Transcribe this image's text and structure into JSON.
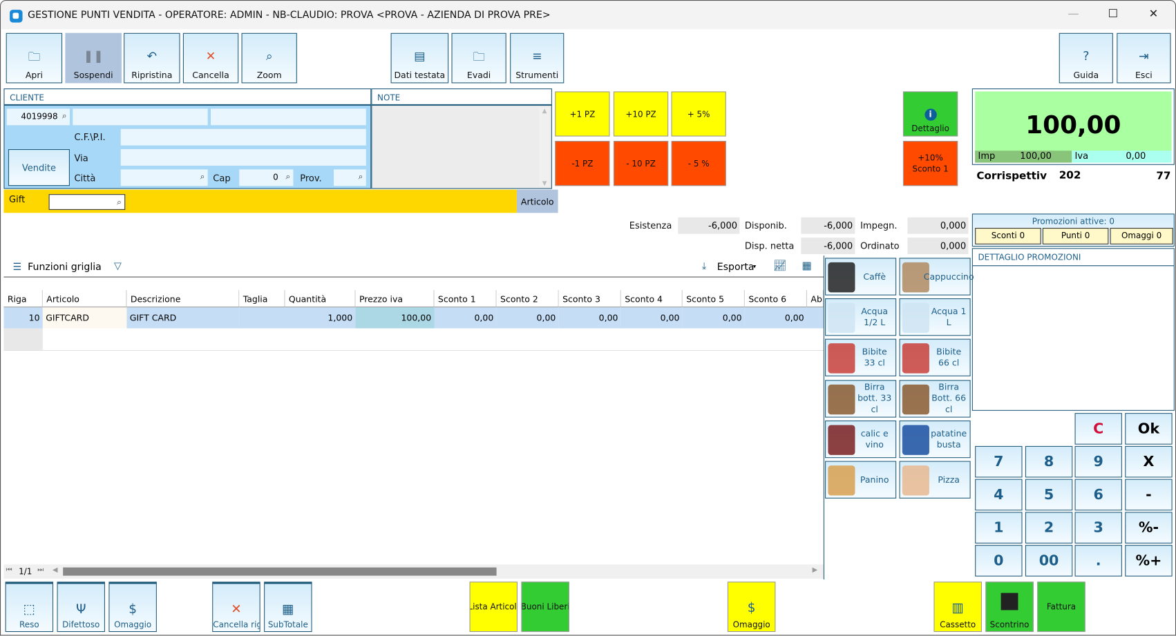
{
  "window": {
    "title": "GESTIONE PUNTI VENDITA - OPERATORE: ADMIN - NB-CLAUDIO: PROVA <PROVA - AZIENDA DI PROVA PRE>",
    "minimize": "—",
    "maximize": "☐",
    "close": "✕"
  },
  "toolbar": [
    {
      "label": "Apri",
      "icon": "folder-icon",
      "glyph": "🗀"
    },
    {
      "label": "Sospendi",
      "icon": "pause-icon",
      "glyph": "❚❚"
    },
    {
      "label": "Ripristina",
      "icon": "undo-icon",
      "glyph": "↶"
    },
    {
      "label": "Cancella",
      "icon": "close-icon",
      "glyph": "✕"
    },
    {
      "label": "Zoom",
      "icon": "search-icon",
      "glyph": "⌕"
    },
    {
      "label": "Dati testata",
      "icon": "document-icon",
      "glyph": "▤"
    },
    {
      "label": "Evadi",
      "icon": "folder-star-icon",
      "glyph": "🗀"
    },
    {
      "label": "Strumenti",
      "icon": "menu-icon",
      "glyph": "≡"
    },
    {
      "label": "Guida",
      "icon": "help-icon",
      "glyph": "?"
    },
    {
      "label": "Esci",
      "icon": "exit-icon",
      "glyph": "⇥"
    }
  ],
  "cliente": {
    "header": "CLIENTE",
    "code": "4019998",
    "name1": "",
    "name2": "",
    "cfpi_label": "C.F.\\P.I.",
    "cfpi": "",
    "vendite": "Vendite",
    "via_label": "Via",
    "via": "",
    "citta_label": "Città",
    "citta": "",
    "cap_label": "Cap",
    "cap": "0",
    "prov_label": "Prov.",
    "prov": ""
  },
  "note": {
    "header": "NOTE"
  },
  "quick": {
    "plus1": "+1 PZ",
    "plus10": "+10 PZ",
    "plus5pct": "+ 5%",
    "minus1": "-1 PZ",
    "minus10": "- 10 PZ",
    "minus5pct": "- 5 %",
    "dettaglio": "Dettaglio",
    "sconto": "+10%\nSconto 1"
  },
  "total": {
    "amount": "100,00",
    "imp_label": "Imp",
    "imp": "100,00",
    "iva_label": "Iva",
    "iva": "0,00",
    "corr_label": "Corrispettiv",
    "corr_num": "202",
    "corr_right": "77"
  },
  "gift": {
    "label": "Gift",
    "value": "",
    "articolo": "Articolo"
  },
  "stock": {
    "esistenza_label": "Esistenza",
    "esistenza": "-6,000",
    "disponib_label": "Disponib.",
    "disponib": "-6,000",
    "impegn_label": "Impegn.",
    "impegn": "0,000",
    "dispnetta_label": "Disp. netta",
    "dispnetta": "-6,000",
    "ordinato_label": "Ordinato",
    "ordinato": "0,000"
  },
  "promo": {
    "header": "Promozioni attive: 0",
    "sconti": "Sconti 0",
    "punti": "Punti 0",
    "omaggi": "Omaggi 0",
    "detail_header": "DETTAGLIO PROMOZIONI"
  },
  "gridbar": {
    "funzioni": "Funzioni griglia",
    "esporta": "Esporta"
  },
  "grid": {
    "columns": [
      "Riga",
      "Articolo",
      "Descrizione",
      "Taglia",
      "Quantità",
      "Prezzo iva",
      "Sconto 1",
      "Sconto 2",
      "Sconto 3",
      "Sconto 4",
      "Sconto 5",
      "Sconto 6",
      "Ab"
    ],
    "rows": [
      [
        "10",
        "GIFTCARD",
        "GIFT CARD",
        "",
        "1,000",
        "100,00",
        "0,00",
        "0,00",
        "0,00",
        "0,00",
        "0,00",
        "0,00",
        ""
      ]
    ],
    "page": "1/1"
  },
  "products": [
    {
      "label": "Caffè",
      "icon": "coffee-icon",
      "color": "#222222"
    },
    {
      "label": "Cappuccino",
      "icon": "cappuccino-icon",
      "color": "#b08a60"
    },
    {
      "label": "Acqua 1/2 L",
      "icon": "water-bottle-icon",
      "color": "#cfe4f2"
    },
    {
      "label": "Acqua 1 L",
      "icon": "water-bottle-icon",
      "color": "#cfe4f2"
    },
    {
      "label": "Bibite 33 cl",
      "icon": "cans-icon",
      "color": "#c8403a"
    },
    {
      "label": "Bibite 66 cl",
      "icon": "cans-icon",
      "color": "#c8403a"
    },
    {
      "label": "Birra bott. 33 cl",
      "icon": "beer-bottle-icon",
      "color": "#8a5a30"
    },
    {
      "label": "Birra Bott. 66 cl",
      "icon": "beer-bottle-icon",
      "color": "#8a5a30"
    },
    {
      "label": "calic e vino",
      "icon": "wine-glasses-icon",
      "color": "#7a2020"
    },
    {
      "label": "patatine busta",
      "icon": "chips-bag-icon",
      "color": "#1a4fa0"
    },
    {
      "label": "Panino",
      "icon": "sandwich-icon",
      "color": "#d8a050"
    },
    {
      "label": "Pizza",
      "icon": "pizza-icon",
      "color": "#e8b890"
    }
  ],
  "keypad": [
    [
      "",
      "",
      "C",
      "Ok"
    ],
    [
      "7",
      "8",
      "9",
      "X"
    ],
    [
      "4",
      "5",
      "6",
      "-"
    ],
    [
      "1",
      "2",
      "3",
      "%-"
    ],
    [
      "0",
      "00",
      ".",
      "%+"
    ]
  ],
  "bottom": [
    {
      "label": "Reso",
      "icon": "return-icon",
      "glyph": "⬚"
    },
    {
      "label": "Difettoso",
      "icon": "broken-glass-icon",
      "glyph": "Ψ"
    },
    {
      "label": "Omaggio",
      "icon": "dollar-icon",
      "glyph": "$"
    },
    {
      "label": "Cancella rig",
      "icon": "delete-row-icon",
      "glyph": "✕"
    },
    {
      "label": "SubTotale",
      "icon": "calculator-icon",
      "glyph": "▦"
    },
    {
      "label": "Lista Articoli",
      "color": "#ffff00"
    },
    {
      "label": "Buoni Liberi",
      "color": "#33cc33"
    },
    {
      "label": "Omaggio",
      "color": "#ffff00",
      "icon": "dollar-icon",
      "glyph": "$"
    },
    {
      "label": "Cassetto",
      "color": "#ffff00",
      "icon": "cash-drawer-icon",
      "glyph": "▥"
    },
    {
      "label": "Scontrino",
      "color": "#33cc33",
      "icon": "receipt-printer-icon",
      "glyph": "■"
    },
    {
      "label": "Fattura",
      "color": "#33cc33"
    }
  ]
}
